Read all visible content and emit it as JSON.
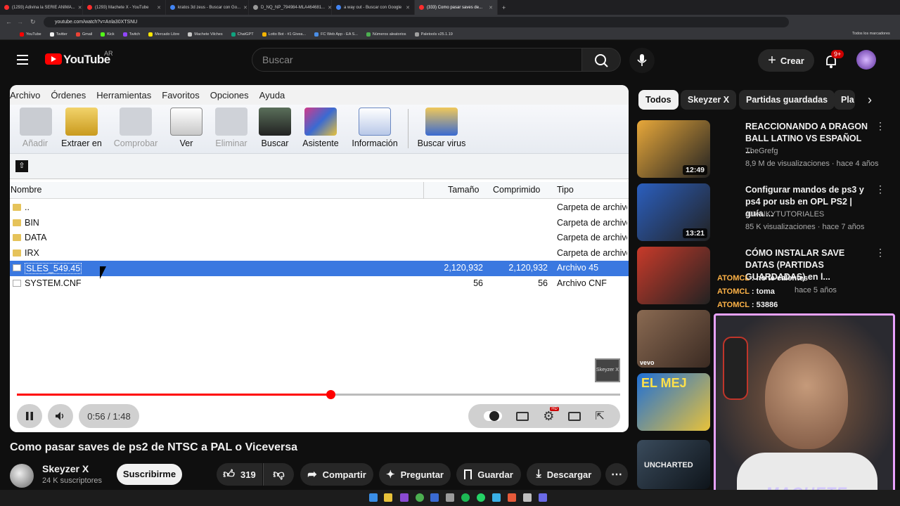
{
  "browser": {
    "tabs": [
      {
        "label": "(1293) Adivina la SERIE ANIMA...",
        "color": "#ff2d2d",
        "active": false
      },
      {
        "label": "(1293) Machete X - YouTube",
        "color": "#ff2d2d",
        "active": false
      },
      {
        "label": "kratos 3d zeus - Buscar con Go...",
        "color": "#4285f4",
        "active": false
      },
      {
        "label": "D_NQ_NP_794984-MLA464681...",
        "color": "#999999",
        "active": false
      },
      {
        "label": "a way out - Buscar con Google",
        "color": "#4285f4",
        "active": false
      },
      {
        "label": "(333) Como pasar saves de...",
        "color": "#ff2d2d",
        "active": true
      }
    ],
    "url": "youtube.com/watch?v=Anla30XTSNU",
    "bookmarks": [
      "YouTube",
      "Twitter",
      "Gmail",
      "Kick",
      "Twitch",
      "Mercado Libre",
      "Machete Vilches",
      "ChatGPT",
      "Lotto Bot - #1 Givea...",
      "FC Web App - EA S...",
      "Números aleatorios",
      "Paletools v25.1.19"
    ],
    "all_bookmarks": "Todos los marcadores"
  },
  "youtube": {
    "logo_text": "YouTube",
    "country": "AR",
    "search_placeholder": "Buscar",
    "create_label": "Crear",
    "notifications_badge": "9+"
  },
  "player": {
    "menu": [
      "Archivo",
      "Órdenes",
      "Herramientas",
      "Favoritos",
      "Opciones",
      "Ayuda"
    ],
    "tools": [
      {
        "label": "Añadir",
        "disabled": true
      },
      {
        "label": "Extraer en",
        "disabled": false
      },
      {
        "label": "Comprobar",
        "disabled": true
      },
      {
        "label": "Ver",
        "disabled": false
      },
      {
        "label": "Eliminar",
        "disabled": true
      },
      {
        "label": "Buscar",
        "disabled": false
      },
      {
        "label": "Asistente",
        "disabled": false
      },
      {
        "label": "Información",
        "disabled": false
      },
      {
        "label": "Buscar virus",
        "disabled": false
      }
    ],
    "columns": {
      "name": "Nombre",
      "size": "Tamaño",
      "compressed": "Comprimido",
      "type": "Tipo"
    },
    "files": [
      {
        "name": "..",
        "size": "",
        "compressed": "",
        "type": "Carpeta de archivos",
        "folder": true,
        "selected": false
      },
      {
        "name": "BIN",
        "size": "",
        "compressed": "",
        "type": "Carpeta de archivos",
        "folder": true,
        "selected": false
      },
      {
        "name": "DATA",
        "size": "",
        "compressed": "",
        "type": "Carpeta de archivos",
        "folder": true,
        "selected": false
      },
      {
        "name": "IRX",
        "size": "",
        "compressed": "",
        "type": "Carpeta de archivos",
        "folder": true,
        "selected": false
      },
      {
        "name": "SLES_549.45",
        "size": "2,120,932",
        "compressed": "2,120,932",
        "type": "Archivo 45",
        "folder": false,
        "selected": true
      },
      {
        "name": "SYSTEM.CNF",
        "size": "56",
        "compressed": "56",
        "type": "Archivo CNF",
        "folder": false,
        "selected": false
      }
    ],
    "watermark": "Skeyzer X",
    "time": "0:56 / 1:48",
    "progress_fraction": 0.52
  },
  "video": {
    "title": "Como pasar saves de ps2 de NTSC a PAL o Viceversa",
    "channel": "Skeyzer X",
    "subscribers": "24 K suscriptores",
    "subscribe_label": "Suscribirme",
    "likes": "319",
    "share_label": "Compartir",
    "ask_label": "Preguntar",
    "save_label": "Guardar",
    "download_label": "Descargar"
  },
  "sidebar": {
    "chips": [
      "Todos",
      "Skeyzer X",
      "Partidas guardadas",
      "Pla"
    ],
    "recommendations": [
      {
        "title": "REACCIONANDO A DRAGON BALL LATINO VS ESPAÑOL ...",
        "channel": "TheGrefg",
        "meta": "8,9 M de visualizaciones · hace 4 años",
        "duration": "12:49",
        "color": "#e8a83a"
      },
      {
        "title": "Configurar mandos de ps3 y ps4 por usb en OPL PS2 | guía ...",
        "channel": "JUANKYTUTORIALES",
        "meta": "85 K visualizaciones · hace 7 años",
        "duration": "13:21",
        "color": "#2b5fbf"
      },
      {
        "title": "CÓMO INSTALAR SAVE DATAS (PARTIDAS GUARDADAS) en l...",
        "channel": "",
        "meta": "hace 5 años",
        "duration": "",
        "color": "#c83a2a"
      }
    ],
    "extra_thumbs": [
      {
        "label": "vevo",
        "color": "#6a4b3a"
      },
      {
        "label": "EL MEJ",
        "color": "#1e6fd6"
      },
      {
        "label": "UNCHARTED",
        "color": "#3a4b5c"
      }
    ]
  },
  "chat": [
    {
      "user": "ATOMCL",
      "text": "no te calentes"
    },
    {
      "user": "ATOMCL",
      "text": "toma"
    },
    {
      "user": "ATOMCL",
      "text": "53886"
    }
  ],
  "webcam_label": "MACHETE"
}
